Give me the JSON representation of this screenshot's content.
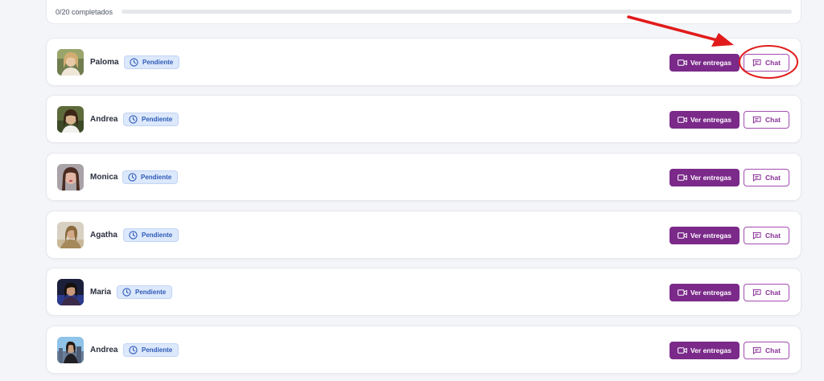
{
  "progress": {
    "text": "0/20 completados",
    "completed": 0,
    "total": 20
  },
  "colors": {
    "accent": "#7b2a8a",
    "badge_bg": "#dce8fb",
    "badge_text": "#2e5bb8",
    "annotation_red": "#e11b1b"
  },
  "creators": [
    {
      "name": "Paloma",
      "status": "Pendiente",
      "ver_label": "Ver entregas",
      "chat_label": "Chat"
    },
    {
      "name": "Andrea",
      "status": "Pendiente",
      "ver_label": "Ver entregas",
      "chat_label": "Chat"
    },
    {
      "name": "Monica",
      "status": "Pendiente",
      "ver_label": "Ver entregas",
      "chat_label": "Chat"
    },
    {
      "name": "Agatha",
      "status": "Pendiente",
      "ver_label": "Ver entregas",
      "chat_label": "Chat"
    },
    {
      "name": "Maria",
      "status": "Pendiente",
      "ver_label": "Ver entregas",
      "chat_label": "Chat"
    },
    {
      "name": "Andrea",
      "status": "Pendiente",
      "ver_label": "Ver entregas",
      "chat_label": "Chat"
    }
  ],
  "icons": {
    "status": "clock-icon",
    "ver": "video-camera-icon",
    "chat": "message-icon"
  }
}
